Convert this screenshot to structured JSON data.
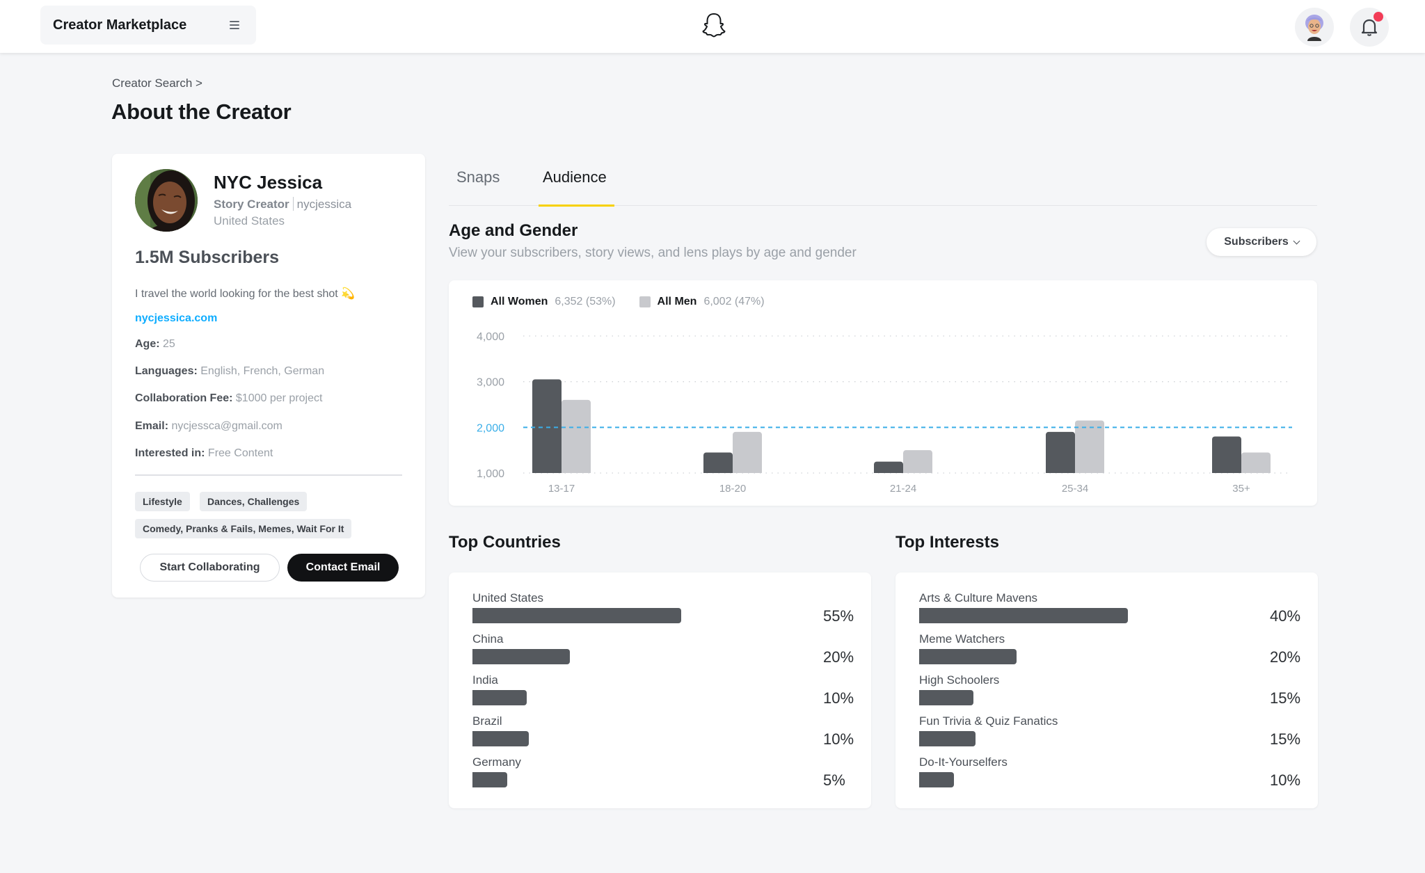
{
  "topbar": {
    "app_title": "Creator Marketplace",
    "menu_icon": "hamburger-menu-icon",
    "logo_icon": "snapchat-ghost-icon",
    "user_avatar_icon": "bitmoji-avatar-icon",
    "notifications_icon": "bell-icon",
    "notification_badge_color": "#f23c57"
  },
  "header": {
    "breadcrumb": "Creator Search >",
    "title": "About the Creator"
  },
  "profile": {
    "name": "NYC Jessica",
    "role": "Story Creator",
    "handle": "nycjessica",
    "country": "United States",
    "subscribers": "1.5M Subscribers",
    "bio": "I travel the world looking for the best shot",
    "bio_emoji": "💫",
    "website": "nycjessica.com",
    "details": [
      {
        "key": "Age:",
        "value": "25"
      },
      {
        "key": "Languages:",
        "value": "English, French, German"
      },
      {
        "key": "Collaboration Fee:",
        "value": "$1000 per project"
      },
      {
        "key": "Email:",
        "value": "nycjessca@gmail.com"
      },
      {
        "key": "Interested in:",
        "value": "Free Content"
      }
    ],
    "tags": [
      "Lifestyle",
      "Dances, Challenges",
      "Comedy, Pranks & Fails, Memes, Wait For It"
    ],
    "start_collab_label": "Start Collaborating",
    "contact_email_label": "Contact Email"
  },
  "tabs": [
    {
      "label": "Snaps",
      "active": false
    },
    {
      "label": "Audience",
      "active": true
    }
  ],
  "age_gender": {
    "title": "Age and Gender",
    "subtitle": "View your subscribers, story views, and lens plays  by age and gender",
    "dropdown_value": "Subscribers"
  },
  "colors": {
    "women": "#55595e",
    "men": "#c8c9cd",
    "reference_line": "#3aaee8",
    "tab_underline": "#f7d100",
    "link": "#0fadff"
  },
  "chart_data": {
    "type": "bar",
    "title": "Age and Gender",
    "categories": [
      "13-17",
      "18-20",
      "21-24",
      "25-34",
      "35+"
    ],
    "series": [
      {
        "name": "All Women",
        "summary": "6,352 (53%)",
        "values": [
          3050,
          1450,
          1250,
          1900,
          1800
        ]
      },
      {
        "name": "All Men",
        "summary": "6,002 (47%)",
        "values": [
          2600,
          1900,
          1500,
          2150,
          1450
        ]
      }
    ],
    "yticks": [
      "1,000",
      "2,000",
      "3,000",
      "4,000"
    ],
    "ytick_values": [
      1000,
      2000,
      3000,
      4000
    ],
    "ylim": [
      1000,
      4000
    ],
    "reference_line": 2000,
    "grid": true,
    "legend_position": "top-left",
    "xlabel": "",
    "ylabel": ""
  },
  "top_countries": {
    "title": "Top Countries",
    "items": [
      {
        "label": "United States",
        "pct": "55%",
        "fill": 1.0
      },
      {
        "label": "China",
        "pct": "20%",
        "fill": 0.465
      },
      {
        "label": "India",
        "pct": "10%",
        "fill": 0.26
      },
      {
        "label": "Brazil",
        "pct": "10%",
        "fill": 0.27
      },
      {
        "label": "Germany",
        "pct": "5%",
        "fill": 0.165
      }
    ]
  },
  "top_interests": {
    "title": "Top Interests",
    "items": [
      {
        "label": "Arts & Culture Mavens",
        "pct": "40%",
        "fill": 1.0
      },
      {
        "label": "Meme Watchers",
        "pct": "20%",
        "fill": 0.465
      },
      {
        "label": "High Schoolers",
        "pct": "15%",
        "fill": 0.26
      },
      {
        "label": "Fun Trivia & Quiz Fanatics",
        "pct": "15%",
        "fill": 0.27
      },
      {
        "label": "Do-It-Yourselfers",
        "pct": "10%",
        "fill": 0.165
      }
    ]
  }
}
